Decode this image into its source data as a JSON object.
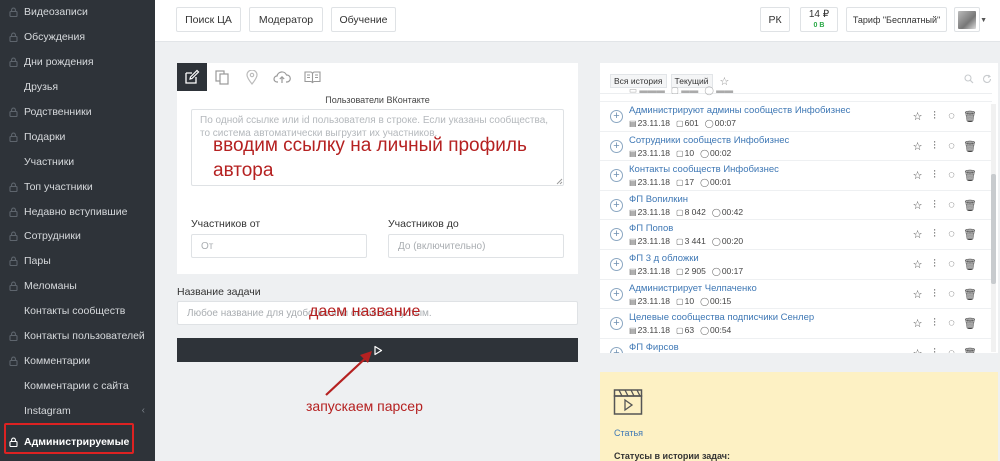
{
  "sidebar": {
    "items": [
      {
        "label": "Видеозаписи",
        "locked": true
      },
      {
        "label": "Обсуждения",
        "locked": true
      },
      {
        "label": "Дни рождения",
        "locked": true
      },
      {
        "label": "Друзья",
        "locked": false
      },
      {
        "label": "Родственники",
        "locked": true
      },
      {
        "label": "Подарки",
        "locked": true
      },
      {
        "label": "Участники",
        "locked": false
      },
      {
        "label": "Топ участники",
        "locked": true
      },
      {
        "label": "Недавно вступившие",
        "locked": true
      },
      {
        "label": "Сотрудники",
        "locked": true
      },
      {
        "label": "Пары",
        "locked": true
      },
      {
        "label": "Меломаны",
        "locked": true
      },
      {
        "label": "Контакты сообществ",
        "locked": false
      },
      {
        "label": "Контакты пользователей",
        "locked": true
      },
      {
        "label": "Комментарии",
        "locked": true
      },
      {
        "label": "Комментарии с сайта",
        "locked": false
      },
      {
        "label": "Instagram",
        "locked": false
      }
    ],
    "active_label": "Администрируемые",
    "collapse_glyph": "‹"
  },
  "topbar": {
    "btn_search": "Поиск ЦА",
    "btn_moderator": "Модератор",
    "btn_training": "Обучение",
    "btn_pk": "РК",
    "balance_rub": "14 ₽",
    "balance_points": "0 B",
    "tariff": "Тариф \"Бесплатный\""
  },
  "form": {
    "tool_icons": [
      "edit-icon",
      "copy-icon",
      "map-pin-icon",
      "cloud-upload-icon",
      "book-icon"
    ],
    "vk_users_label": "Пользователи ВКонтакте",
    "textarea_placeholder": "По одной ссылке или id пользователя в строке. Если указаны сообщества, то система автоматически выгрузит их участников.",
    "members_from_label": "Участников от",
    "members_from_placeholder": "От",
    "members_to_label": "Участников до",
    "members_to_placeholder": "До (включительно)",
    "task_name_label": "Название задачи",
    "task_name_placeholder": "Любое название для удобства или оставить пустым."
  },
  "annotations": {
    "link_hint_line1": "вводим ссылку на личный профиль",
    "link_hint_line2": "автора",
    "name_hint": "даем название",
    "run_hint": "запускаем парсер"
  },
  "history": {
    "tab_all": "Вся история",
    "tab_current": "Текущий",
    "rows": [
      {
        "name": "Администрируют админы сообществ Инфобизнес",
        "date": "23.11.18",
        "count": "601",
        "time": "00:07"
      },
      {
        "name": "Сотрудники сообществ Инфобизнес",
        "date": "23.11.18",
        "count": "10",
        "time": "00:02"
      },
      {
        "name": "Контакты сообществ Инфобизнес",
        "date": "23.11.18",
        "count": "17",
        "time": "00:01"
      },
      {
        "name": "ФП Вопилкин",
        "date": "23.11.18",
        "count": "8 042",
        "time": "00:42"
      },
      {
        "name": "ФП Попов",
        "date": "23.11.18",
        "count": "3 441",
        "time": "00:20"
      },
      {
        "name": "ФП 3 д обложки",
        "date": "23.11.18",
        "count": "2 905",
        "time": "00:17"
      },
      {
        "name": "Администрирует Челпаченко",
        "date": "23.11.18",
        "count": "10",
        "time": "00:15"
      },
      {
        "name": "Целевые сообщества подписчики Сенлер",
        "date": "23.11.18",
        "count": "63",
        "time": "00:54"
      },
      {
        "name": "ФП Фирсов",
        "date": "",
        "count": "",
        "time": ""
      }
    ]
  },
  "article": {
    "link_label": "Статья",
    "statuses_label": "Статусы в истории задач:"
  },
  "colors": {
    "sidebar_bg": "#2e3339",
    "annotation_red": "#b52121",
    "link_blue": "#3f78b5",
    "article_bg": "#fdf1c4"
  }
}
